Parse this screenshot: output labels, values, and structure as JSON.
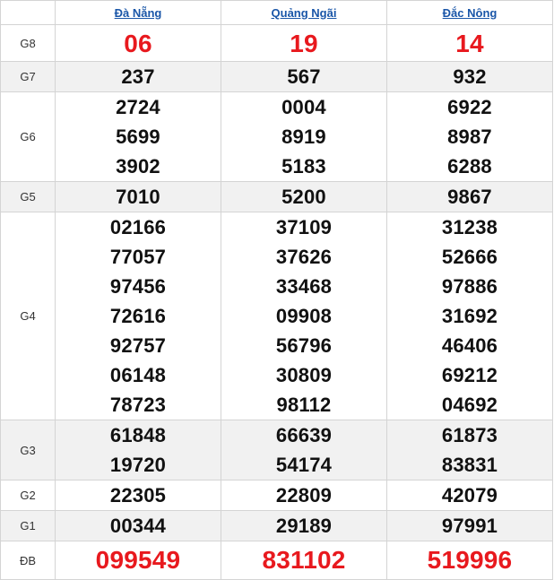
{
  "provinces": [
    {
      "name": "Đà Nẵng"
    },
    {
      "name": "Quảng Ngãi"
    },
    {
      "name": "Đắc Nông"
    }
  ],
  "prizes": [
    {
      "label": "G8",
      "values": [
        [
          "06"
        ],
        [
          "19"
        ],
        [
          "14"
        ]
      ]
    },
    {
      "label": "G7",
      "values": [
        [
          "237"
        ],
        [
          "567"
        ],
        [
          "932"
        ]
      ]
    },
    {
      "label": "G6",
      "values": [
        [
          "2724",
          "5699",
          "3902"
        ],
        [
          "0004",
          "8919",
          "5183"
        ],
        [
          "6922",
          "8987",
          "6288"
        ]
      ]
    },
    {
      "label": "G5",
      "values": [
        [
          "7010"
        ],
        [
          "5200"
        ],
        [
          "9867"
        ]
      ]
    },
    {
      "label": "G4",
      "values": [
        [
          "02166",
          "77057",
          "97456",
          "72616",
          "92757",
          "06148",
          "78723"
        ],
        [
          "37109",
          "37626",
          "33468",
          "09908",
          "56796",
          "30809",
          "98112"
        ],
        [
          "31238",
          "52666",
          "97886",
          "31692",
          "46406",
          "69212",
          "04692"
        ]
      ]
    },
    {
      "label": "G3",
      "values": [
        [
          "61848",
          "19720"
        ],
        [
          "66639",
          "54174"
        ],
        [
          "61873",
          "83831"
        ]
      ]
    },
    {
      "label": "G2",
      "values": [
        [
          "22305"
        ],
        [
          "22809"
        ],
        [
          "42079"
        ]
      ]
    },
    {
      "label": "G1",
      "values": [
        [
          "00344"
        ],
        [
          "29189"
        ],
        [
          "97991"
        ]
      ]
    },
    {
      "label": "ĐB",
      "values": [
        [
          "099549"
        ],
        [
          "831102"
        ],
        [
          "519996"
        ]
      ]
    }
  ],
  "colors": {
    "special_number": "#e8191e",
    "province_link": "#1a56a8",
    "alt_row_bg": "#f1f1f1",
    "border": "#d4d4d4"
  }
}
